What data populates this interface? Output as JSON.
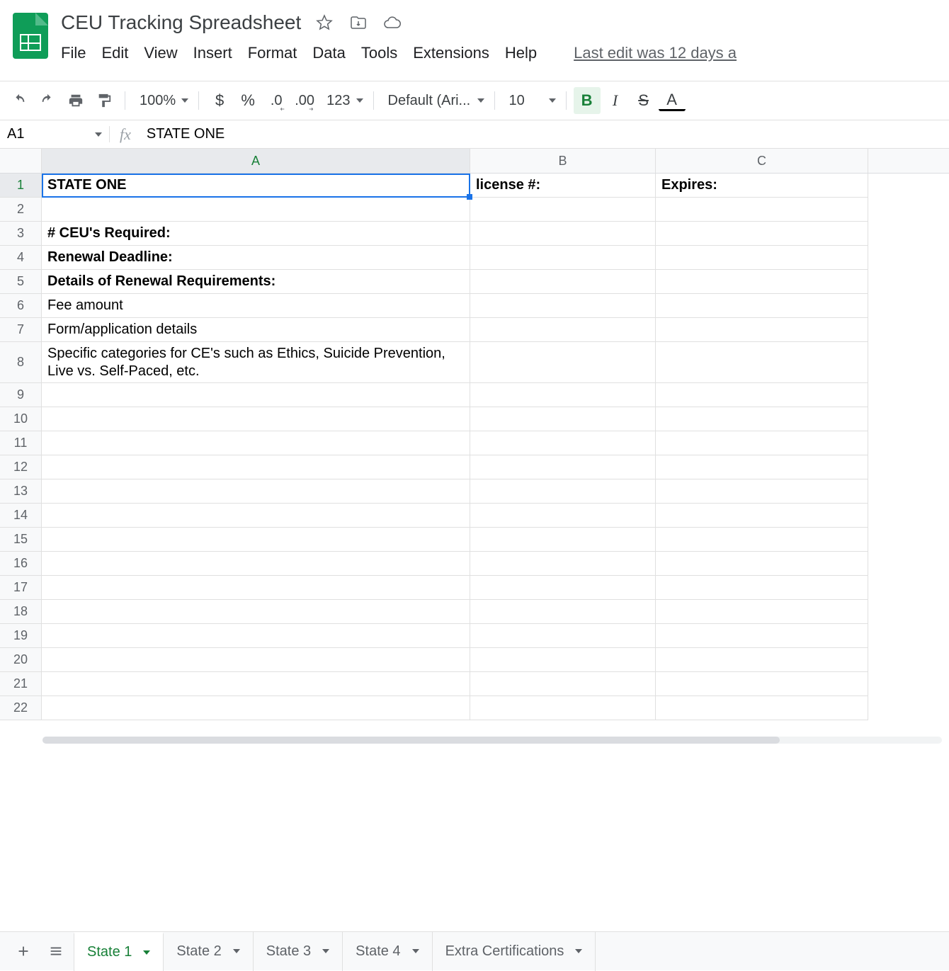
{
  "doc": {
    "title": "CEU Tracking Spreadsheet",
    "last_edit": "Last edit was 12 days a"
  },
  "menus": [
    "File",
    "Edit",
    "View",
    "Insert",
    "Format",
    "Data",
    "Tools",
    "Extensions",
    "Help"
  ],
  "toolbar": {
    "zoom": "100%",
    "currency": "$",
    "percent": "%",
    "dec_dec": ".0",
    "inc_dec": ".00",
    "numfmt": "123",
    "font": "Default (Ari...",
    "size": "10",
    "bold": "B",
    "italic": "I",
    "strike": "S",
    "textcolor": "A"
  },
  "namebox": "A1",
  "fx_label": "fx",
  "formula": "STATE ONE",
  "columns": [
    "A",
    "B",
    "C"
  ],
  "rows": [
    {
      "n": "1",
      "h": "std",
      "a": "STATE ONE",
      "abold": true,
      "b": "license #:",
      "bbold": true,
      "c": "Expires:",
      "cbold": true
    },
    {
      "n": "2",
      "h": "std",
      "a": "",
      "b": "",
      "c": ""
    },
    {
      "n": "3",
      "h": "std",
      "a": "# CEU's Required:",
      "abold": true,
      "b": "",
      "c": ""
    },
    {
      "n": "4",
      "h": "std",
      "a": "Renewal Deadline:",
      "abold": true,
      "b": "",
      "c": ""
    },
    {
      "n": "5",
      "h": "std",
      "a": "Details of Renewal Requirements:",
      "abold": true,
      "b": "",
      "c": ""
    },
    {
      "n": "6",
      "h": "std",
      "a": "Fee amount",
      "b": "",
      "c": ""
    },
    {
      "n": "7",
      "h": "std",
      "a": "Form/application details",
      "b": "",
      "c": ""
    },
    {
      "n": "8",
      "h": "tall",
      "a": "Specific categories for CE's such as Ethics, Suicide Prevention, Live vs. Self-Paced, etc.",
      "b": "",
      "c": ""
    },
    {
      "n": "9",
      "h": "std",
      "a": "",
      "b": "",
      "c": ""
    },
    {
      "n": "10",
      "h": "std",
      "a": "",
      "b": "",
      "c": ""
    },
    {
      "n": "11",
      "h": "std",
      "a": "",
      "b": "",
      "c": ""
    },
    {
      "n": "12",
      "h": "std",
      "a": "",
      "b": "",
      "c": ""
    },
    {
      "n": "13",
      "h": "std",
      "a": "",
      "b": "",
      "c": ""
    },
    {
      "n": "14",
      "h": "std",
      "a": "",
      "b": "",
      "c": ""
    },
    {
      "n": "15",
      "h": "std",
      "a": "",
      "b": "",
      "c": ""
    },
    {
      "n": "16",
      "h": "std",
      "a": "",
      "b": "",
      "c": ""
    },
    {
      "n": "17",
      "h": "std",
      "a": "",
      "b": "",
      "c": ""
    },
    {
      "n": "18",
      "h": "std",
      "a": "",
      "b": "",
      "c": ""
    },
    {
      "n": "19",
      "h": "std",
      "a": "",
      "b": "",
      "c": ""
    },
    {
      "n": "20",
      "h": "std",
      "a": "",
      "b": "",
      "c": ""
    },
    {
      "n": "21",
      "h": "std",
      "a": "",
      "b": "",
      "c": ""
    },
    {
      "n": "22",
      "h": "std",
      "a": "",
      "b": "",
      "c": ""
    }
  ],
  "tabs": [
    {
      "label": "State 1",
      "active": true
    },
    {
      "label": "State 2",
      "active": false
    },
    {
      "label": "State 3",
      "active": false
    },
    {
      "label": "State 4",
      "active": false
    },
    {
      "label": "Extra Certifications",
      "active": false
    }
  ]
}
